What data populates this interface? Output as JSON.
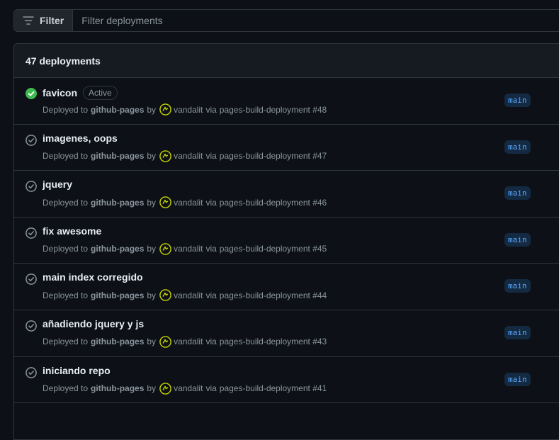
{
  "filter": {
    "button_label": "Filter",
    "placeholder": "Filter deployments"
  },
  "header": {
    "count_label": "47 deployments"
  },
  "deployments": [
    {
      "title": "favicon",
      "status": "success",
      "badge": "Active",
      "prefix": "Deployed to",
      "environment": "github-pages",
      "by": "by",
      "user": "vandalit",
      "via": "via",
      "workflow": "pages-build-deployment #48",
      "branch": "main"
    },
    {
      "title": "imagenes, oops",
      "status": "inactive",
      "prefix": "Deployed to",
      "environment": "github-pages",
      "by": "by",
      "user": "vandalit",
      "via": "via",
      "workflow": "pages-build-deployment #47",
      "branch": "main"
    },
    {
      "title": "jquery",
      "status": "inactive",
      "prefix": "Deployed to",
      "environment": "github-pages",
      "by": "by",
      "user": "vandalit",
      "via": "via",
      "workflow": "pages-build-deployment #46",
      "branch": "main"
    },
    {
      "title": "fix awesome",
      "status": "inactive",
      "prefix": "Deployed to",
      "environment": "github-pages",
      "by": "by",
      "user": "vandalit",
      "via": "via",
      "workflow": "pages-build-deployment #45",
      "branch": "main"
    },
    {
      "title": "main index corregido",
      "status": "inactive",
      "prefix": "Deployed to",
      "environment": "github-pages",
      "by": "by",
      "user": "vandalit",
      "via": "via",
      "workflow": "pages-build-deployment #44",
      "branch": "main"
    },
    {
      "title": "añadiendo jquery y js",
      "status": "inactive",
      "prefix": "Deployed to",
      "environment": "github-pages",
      "by": "by",
      "user": "vandalit",
      "via": "via",
      "workflow": "pages-build-deployment #43",
      "branch": "main"
    },
    {
      "title": "iniciando repo",
      "status": "inactive",
      "prefix": "Deployed to",
      "environment": "github-pages",
      "by": "by",
      "user": "vandalit",
      "via": "via",
      "workflow": "pages-build-deployment #41",
      "branch": "main"
    }
  ],
  "icons": {
    "filter": "filter-icon",
    "success": "check-circle-fill-icon",
    "inactive": "check-circle-icon",
    "avatar": "avatar"
  },
  "colors": {
    "background": "#0d1117",
    "header": "#161b22",
    "border": "#30363d",
    "success": "#3fb950",
    "muted": "#8b949e",
    "branch_bg": "#132a42",
    "branch_fg": "#58a6ff",
    "avatar": "#c8d400"
  }
}
